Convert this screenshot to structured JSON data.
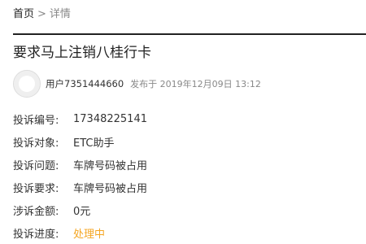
{
  "breadcrumb": {
    "home": "首页",
    "separator": ">",
    "current": "详情"
  },
  "complaint": {
    "title": "要求马上注销八桂行卡",
    "author": {
      "username": "用户7351444660",
      "posted_prefix": "发布于",
      "posted_time": "2019年12月09日 13:12"
    },
    "fields": [
      {
        "label": "投诉编号:",
        "value": "17348225141"
      },
      {
        "label": "投诉对象:",
        "value": "ETC助手"
      },
      {
        "label": "投诉问题:",
        "value": "车牌号码被占用"
      },
      {
        "label": "投诉要求:",
        "value": "车牌号码被占用"
      },
      {
        "label": "涉诉金额:",
        "value": "0元"
      },
      {
        "label": "投诉进度:",
        "value": "处理中"
      }
    ]
  },
  "colors": {
    "status": "#f5a623",
    "divider": "#222222"
  }
}
